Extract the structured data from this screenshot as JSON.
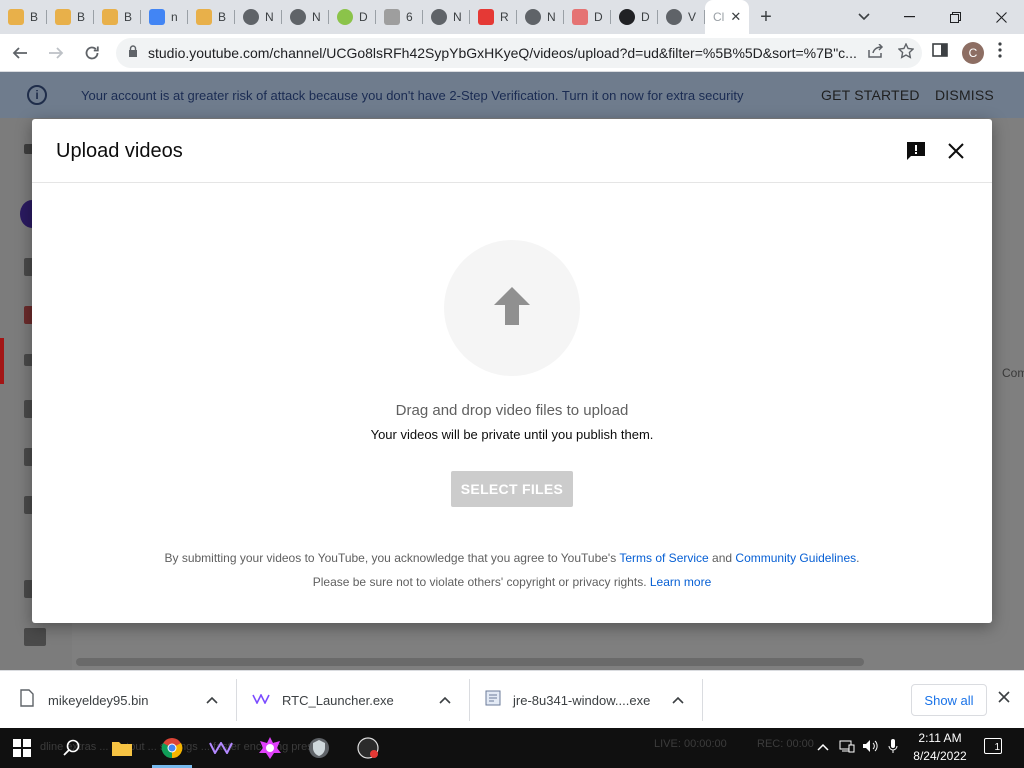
{
  "browser": {
    "tabs": [
      {
        "label": "B",
        "icon": "meme-favicon",
        "color": "#e8b04a"
      },
      {
        "label": "B",
        "icon": "meme-favicon",
        "color": "#e8b04a"
      },
      {
        "label": "B",
        "icon": "meme-favicon",
        "color": "#e8b04a"
      },
      {
        "label": "n",
        "icon": "google-favicon",
        "color": "#4285f4"
      },
      {
        "label": "B",
        "icon": "meme-favicon",
        "color": "#e8b04a"
      },
      {
        "label": "N",
        "icon": "chrome-favicon",
        "color": "#5f6368"
      },
      {
        "label": "N",
        "icon": "chrome-favicon",
        "color": "#5f6368"
      },
      {
        "label": "D",
        "icon": "globe-favicon",
        "color": "#8bc34a"
      },
      {
        "label": "6",
        "icon": "doc-favicon",
        "color": "#9e9e9e"
      },
      {
        "label": "N",
        "icon": "chrome-favicon",
        "color": "#5f6368"
      },
      {
        "label": "R",
        "icon": "warning-favicon",
        "color": "#e53935"
      },
      {
        "label": "N",
        "icon": "chrome-favicon",
        "color": "#5f6368"
      },
      {
        "label": "D",
        "icon": "store-favicon",
        "color": "#e57373"
      },
      {
        "label": "D",
        "icon": "dark-favicon",
        "color": "#202124"
      },
      {
        "label": "V",
        "icon": "globe-favicon",
        "color": "#5f6368"
      }
    ],
    "active_tab": {
      "label": "Cl",
      "close": "✕"
    },
    "new_tab": "+",
    "address": "studio.youtube.com/channel/UCGo8lsRFh42SypYbGxHKyeQ/videos/upload?d=ud&filter=%5B%5D&sort=%7B\"c...",
    "profile_initial": "C"
  },
  "banner": {
    "message": "Your account is at greater risk of attack because you don't have 2-Step Verification. Turn it on now for extra security",
    "get_started": "GET STARTED",
    "dismiss": "DISMISS"
  },
  "background_page": {
    "right_text": "Com"
  },
  "dialog": {
    "title": "Upload videos",
    "drag_text": "Drag and drop video files to upload",
    "private_text": "Your videos will be private until you publish them.",
    "select_button": "SELECT FILES",
    "legal": {
      "line1_prefix": "By submitting your videos to YouTube, you acknowledge that you agree to YouTube's",
      "terms": "Terms of Service",
      "and": "and",
      "guidelines": "Community Guidelines",
      "period": ".",
      "line2_prefix": "Please be sure not to violate others' copyright or privacy rights.",
      "learn_more": "Learn more"
    }
  },
  "downloads": {
    "items": [
      {
        "name": "mikeyeldey95.bin"
      },
      {
        "name": "RTC_Launcher.exe"
      },
      {
        "name": "jre-8u341-window....exe"
      }
    ],
    "show_all": "Show all"
  },
  "taskbar": {
    "background_text": "dline extras ... Output ... settings ... faster encoding preset.",
    "live_text": "LIVE: 00:00:00",
    "rec_text": "REC: 00:00",
    "time": "2:11 AM",
    "date": "8/24/2022",
    "notification_count": "1"
  },
  "colors": {
    "link": "#065fd4",
    "banner_bg": "#6f7c8d",
    "button_disabled": "#cccccc",
    "overlay": "#7f7f7f"
  }
}
